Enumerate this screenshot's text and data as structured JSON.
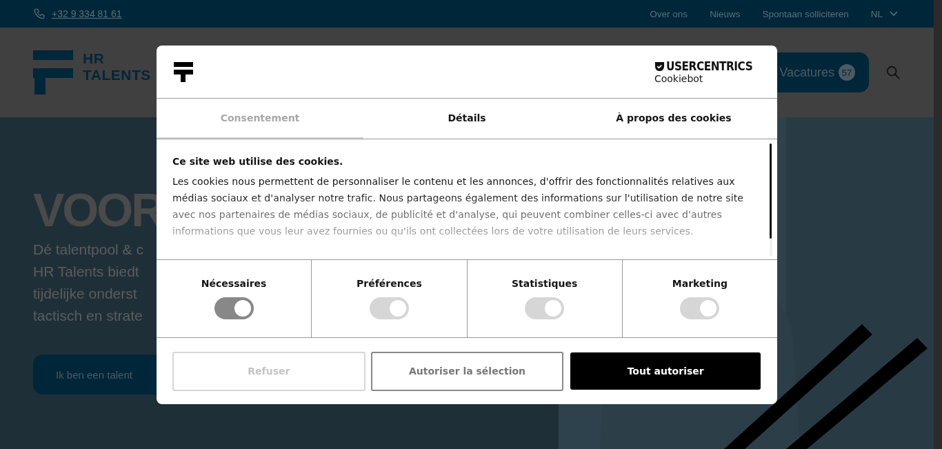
{
  "top_bar": {
    "phone": "+32 9 334 81 61",
    "links": [
      "Over ons",
      "Nieuws",
      "Spontaan solliciteren"
    ],
    "language": "NL"
  },
  "header": {
    "logo_lines": [
      "HR",
      "TALENTS"
    ],
    "vacatures": {
      "label": "Vacatures",
      "count": "57"
    }
  },
  "hero": {
    "heading": "VOOR",
    "lines": [
      "Dé talentpool & c",
      "HR Talents biedt",
      "tijdelijke onderst",
      "tactisch en strate"
    ],
    "button": "Ik ben een talent"
  },
  "cookie_dialog": {
    "brand": {
      "name": "USERCENTRICS",
      "product": "Cookiebot"
    },
    "tabs": [
      {
        "label": "Consentement",
        "selected": true
      },
      {
        "label": "Détails",
        "selected": false
      },
      {
        "label": "À propos des cookies",
        "selected": false
      }
    ],
    "title": "Ce site web utilise des cookies.",
    "body": "Les cookies nous permettent de personnaliser le contenu et les annonces, d'offrir des fonctionnalités relatives aux médias sociaux et d'analyser notre trafic. Nous partageons également des informations sur l'utilisation de notre site avec nos partenaires de médias sociaux, de publicité et d'analyse, qui peuvent combiner celles-ci avec d'autres informations que vous leur avez fournies ou qu'ils ont collectées lors de votre utilisation de leurs services.",
    "categories": [
      {
        "label": "Nécessaires",
        "checked": true,
        "disabled": true
      },
      {
        "label": "Préférences",
        "checked": true,
        "disabled": false
      },
      {
        "label": "Statistiques",
        "checked": true,
        "disabled": false
      },
      {
        "label": "Marketing",
        "checked": true,
        "disabled": false
      }
    ],
    "buttons": [
      {
        "label": "Refuser",
        "kind": "faint"
      },
      {
        "label": "Autoriser la sélection",
        "kind": "outline"
      },
      {
        "label": "Tout autoriser",
        "kind": "solid"
      }
    ]
  }
}
